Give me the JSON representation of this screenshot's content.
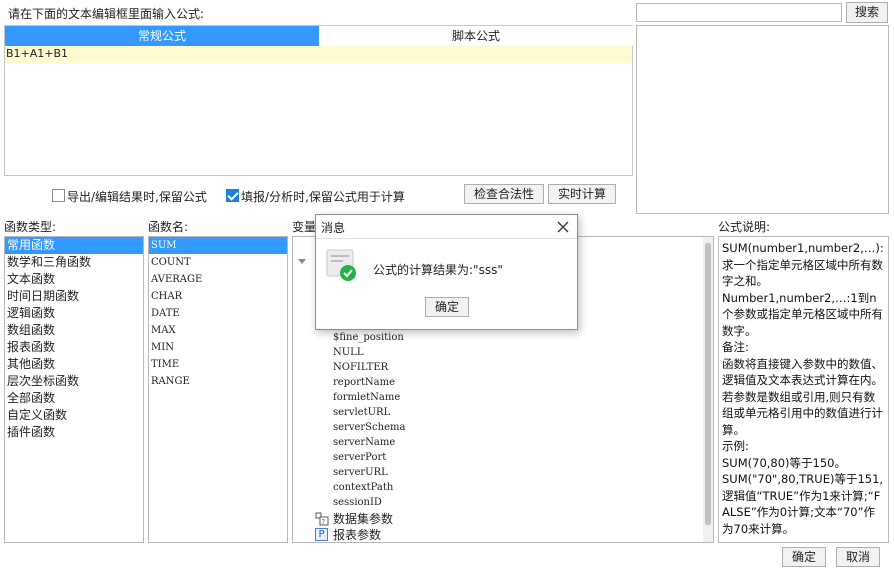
{
  "editor": {
    "prompt": "请在下面的文本编辑框里面输入公式:",
    "tabs": [
      {
        "label": "常规公式",
        "active": true
      },
      {
        "label": "脚本公式",
        "active": false
      }
    ],
    "formula_text": "B1+A1+B1"
  },
  "search": {
    "value": "",
    "placeholder": "",
    "button_label": "搜索"
  },
  "options": {
    "keep_on_export": {
      "label": "导出/编辑结果时,保留公式",
      "checked": false
    },
    "keep_on_fill": {
      "label": "填报/分析时,保留公式用于计算",
      "checked": true
    },
    "check_button": "检查合法性",
    "realtime_button": "实时计算"
  },
  "function_types": {
    "header": "函数类型:",
    "items": [
      "常用函数",
      "数学和三角函数",
      "文本函数",
      "时间日期函数",
      "逻辑函数",
      "数组函数",
      "报表函数",
      "其他函数",
      "层次坐标函数",
      "全部函数",
      "自定义函数",
      "插件函数"
    ],
    "selected": 0
  },
  "function_names": {
    "header": "函数名:",
    "items": [
      "SUM",
      "COUNT",
      "AVERAGE",
      "CHAR",
      "DATE",
      "MAX",
      "MIN",
      "TIME",
      "RANGE"
    ],
    "selected": 0
  },
  "variables": {
    "header": "变量",
    "items": [
      "$fine_position",
      "NULL",
      "NOFILTER",
      "reportName",
      "formletName",
      "servletURL",
      "serverSchema",
      "serverName",
      "serverPort",
      "serverURL",
      "contextPath",
      "sessionID"
    ],
    "groups": [
      "数据集参数",
      "报表参数"
    ]
  },
  "description": {
    "header": "公式说明:",
    "lines": [
      {
        "t": "SUM(number1,number2,…):求一个指定单元格区域中所有数字之和。"
      },
      {
        "t": "Number1,number2,…:1到n个参数或指定单元格区域中所有数字。"
      },
      {
        "t": "备注:"
      },
      {
        "t": "函数将直接键入参数中的数值、逻辑值及文本表达式计算在内。若参数是数组或引用,则只有数组或单元格引用中的数值进行计算。"
      },
      {
        "t": "示例:"
      },
      {
        "t": "SUM(70,80)等于150。"
      },
      {
        "t": "SUM(\"70\",80,TRUE)等于151,逻辑值“TRUE”作为1来计算;“FALSE”作为0计算;文本“70”作为70来计算。"
      }
    ]
  },
  "dialog": {
    "title": "消息",
    "message": "公式的计算结果为:\"sss\"",
    "ok_label": "确定"
  },
  "footer": {
    "ok_label": "确定",
    "cancel_label": "取消"
  },
  "colors": {
    "accent": "#3399ff",
    "formula_bg": "#fffbd0",
    "success": "#21b14b"
  }
}
